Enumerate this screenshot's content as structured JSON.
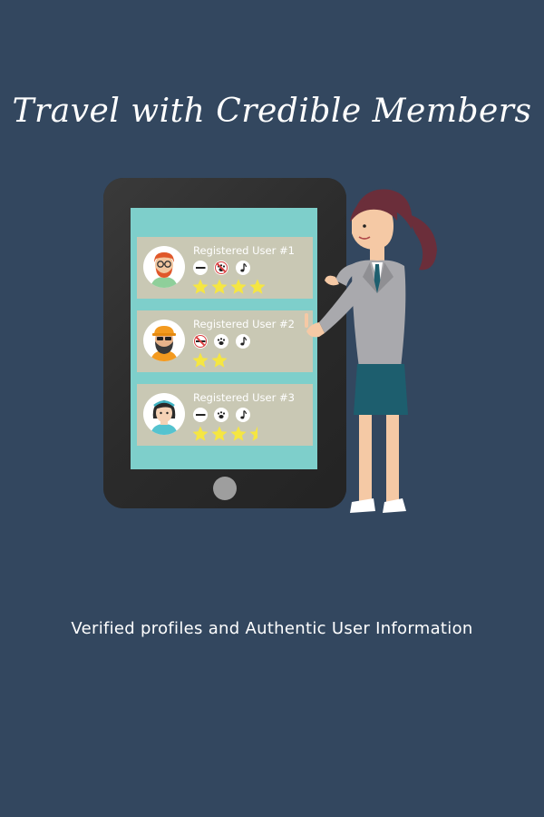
{
  "title": "Travel with Credible Members",
  "subtitle": "Verified profiles and Authentic User Information",
  "colors": {
    "background": "#33475f",
    "screen": "#7ecfcb",
    "card": "#c9c8b4",
    "star": "#f5e642",
    "no_symbol": "#d94040"
  },
  "cards": [
    {
      "label": "Registered User #1",
      "avatar": "red-haired-man-with-glasses",
      "preferences": [
        {
          "icon": "cigarette-icon",
          "allowed": true
        },
        {
          "icon": "paw-icon",
          "allowed": false
        },
        {
          "icon": "music-note-icon",
          "allowed": true
        }
      ],
      "rating": 4
    },
    {
      "label": "Registered User #2",
      "avatar": "bearded-man-with-hat",
      "preferences": [
        {
          "icon": "cigarette-icon",
          "allowed": false
        },
        {
          "icon": "paw-icon",
          "allowed": true
        },
        {
          "icon": "music-note-icon",
          "allowed": true
        }
      ],
      "rating": 2
    },
    {
      "label": "Registered User #3",
      "avatar": "woman-with-headband",
      "preferences": [
        {
          "icon": "cigarette-icon",
          "allowed": true
        },
        {
          "icon": "paw-icon",
          "allowed": true
        },
        {
          "icon": "music-note-icon",
          "allowed": true
        }
      ],
      "rating": 3.5
    }
  ]
}
